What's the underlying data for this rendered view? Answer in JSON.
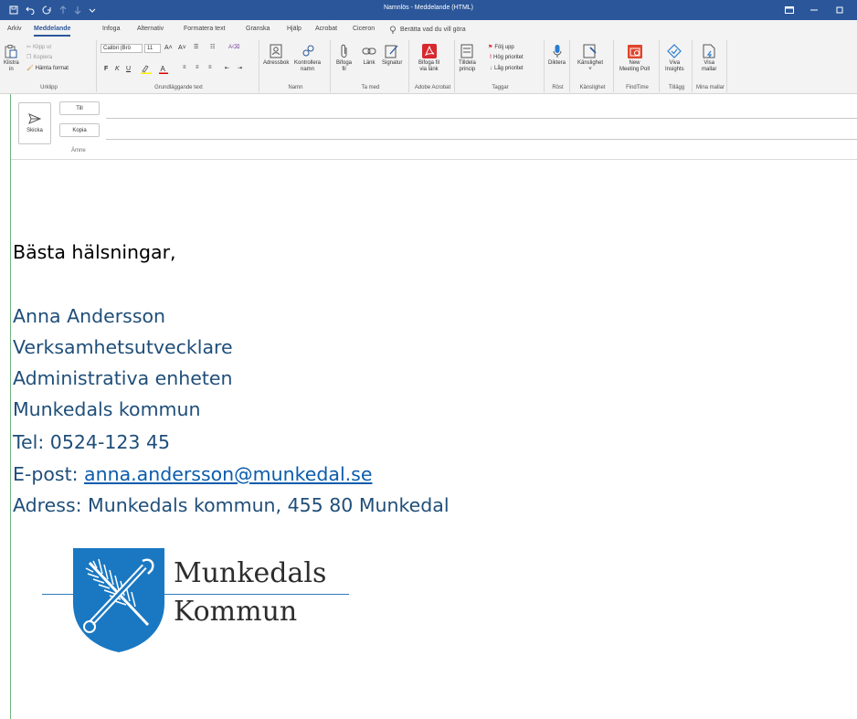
{
  "window": {
    "title": "Namnlös  -  Meddelande (HTML)"
  },
  "tabs": [
    "Arkiv",
    "Meddelande",
    "Infoga",
    "Alternativ",
    "Formatera text",
    "Granska",
    "Hjälp",
    "Acrobat",
    "Ciceron"
  ],
  "tell_me": "Berätta vad du vill göra",
  "ribbon": {
    "clipboard": {
      "paste": "Klistra",
      "paste2": "in",
      "cut": "Klipp ut",
      "copy": "Kopiera",
      "format_painter": "Hämta format",
      "group": "Urklipp"
    },
    "basic_text": {
      "font": "Calibri (Brö",
      "size": "11",
      "bold": "F",
      "italic": "K",
      "underline": "U",
      "group": "Grundläggande text"
    },
    "names": {
      "address_book": "Adressbok",
      "check_names": "Kontrollera",
      "check_names2": "namn",
      "group": "Namn"
    },
    "include": {
      "attach": "Bifoga",
      "attach2": "fil",
      "link": "Länk",
      "signature": "Signatur",
      "group": "Ta med"
    },
    "acrobat": {
      "attach_link": "Bifoga fil",
      "attach_link2": "via länk",
      "group": "Adobe Acrobat"
    },
    "tags": {
      "assign": "Tilldela",
      "assign2": "princip",
      "follow_up": "Följ upp",
      "high": "Hög prioritet",
      "low": "Låg prioritet",
      "group": "Taggar"
    },
    "voice": {
      "dictate": "Diktera",
      "group": "Röst"
    },
    "sensitivity": {
      "label": "Känslighet",
      "group": "Känslighet"
    },
    "findtime": {
      "label": "New",
      "label2": "Meeting Poll",
      "group": "FindTime"
    },
    "addins": {
      "label": "Viva",
      "label2": "Insights",
      "group": "Tillägg"
    },
    "templates": {
      "label": "Visa",
      "label2": "mallar",
      "group": "Mina mallar"
    }
  },
  "compose": {
    "send": "Skicka",
    "to": "Till",
    "cc": "Kopia",
    "subject": "Ämne"
  },
  "body": {
    "greeting": "Bästa hälsningar,",
    "name": "Anna Andersson",
    "role": "Verksamhetsutvecklare",
    "unit": "Administrativa enheten",
    "org": "Munkedals kommun",
    "phone": "Tel: 0524-123 45",
    "email_prefix": "E-post: ",
    "email": "anna.andersson@munkedal.se",
    "address": "Adress: Munkedals kommun, 455 80 Munkedal"
  },
  "logo": {
    "line1": "Munkedals",
    "line2": "Kommun",
    "accent": "#1a78c2"
  }
}
